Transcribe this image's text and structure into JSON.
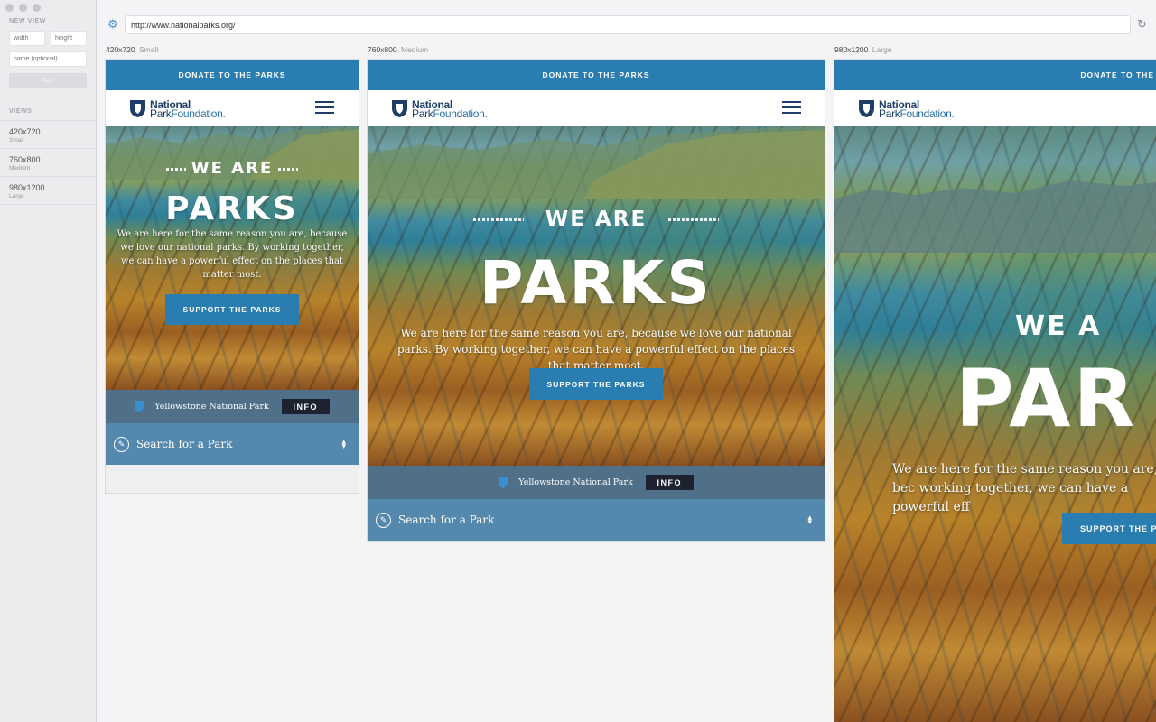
{
  "sidebar": {
    "new_view_heading": "NEW VIEW",
    "width_placeholder": "width",
    "height_placeholder": "height",
    "name_placeholder": "name (optional)",
    "add_label": "Add",
    "views_heading": "VIEWS",
    "views": [
      {
        "size": "420x720",
        "name": "Small"
      },
      {
        "size": "760x800",
        "name": "Medium"
      },
      {
        "size": "980x1200",
        "name": "Large"
      }
    ]
  },
  "toolbar": {
    "url": "http://www.nationalparks.org/",
    "settings_icon": "gear-icon",
    "reload_icon": "reload-icon"
  },
  "frames": [
    {
      "size": "420x720",
      "name": "Small"
    },
    {
      "size": "760x800",
      "name": "Medium"
    },
    {
      "size": "980x1200",
      "name": "Large"
    }
  ],
  "site": {
    "donate": "DONATE TO THE PARKS",
    "logo_line1": "National",
    "logo_line2a": "Park",
    "logo_line2b": "Foundation",
    "logo_dot": ".",
    "we_are": "WE ARE",
    "parks": "PARKS",
    "tagline": "We are here for the same reason you are, because we love our national parks. By working together, we can have a powerful effect on the places that matter most.",
    "tagline_large_visible": "We are here for the same reason you are, bec working together, we can have a powerful eff",
    "support": "SUPPORT THE PARKS",
    "support_large_visible": "SUPPORT THE PA",
    "donate_large_visible": "DONATE TO THE",
    "we_are_large_visible": "WE A",
    "parks_large_visible": "PAR",
    "park_name": "Yellowstone National Park",
    "info": "INFO",
    "search": "Search for a Park"
  },
  "colors": {
    "brand_blue": "#2a7db0",
    "navy": "#1d3e69",
    "info_bg": "#1c2230"
  }
}
